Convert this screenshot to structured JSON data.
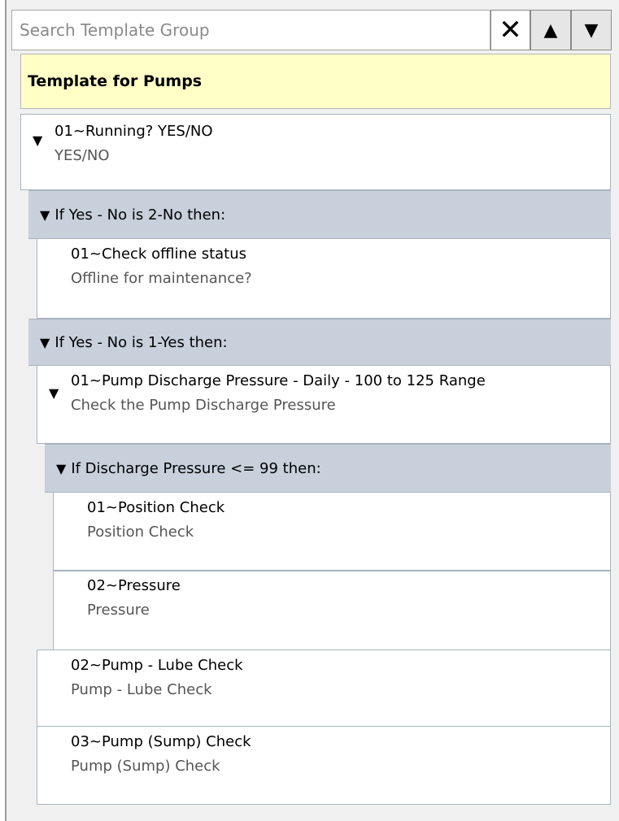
{
  "search": {
    "placeholder": "Search Template Group",
    "value": ""
  },
  "buttons": {
    "clear": "✕",
    "up": "▲",
    "down": "▼"
  },
  "header": {
    "title": "Template for Pumps"
  },
  "nodes": {
    "running": {
      "title": "01~Running? YES/NO",
      "subtitle": "YES/NO"
    },
    "check_offline": {
      "title": "01~Check offline status",
      "subtitle": "Offline for maintenance?"
    },
    "pump_discharge": {
      "title": "01~Pump Discharge Pressure - Daily - 100 to 125 Range",
      "subtitle": "Check the Pump Discharge Pressure"
    },
    "position_check": {
      "title": "01~Position Check",
      "subtitle": "Position Check"
    },
    "pressure": {
      "title": "02~Pressure",
      "subtitle": "Pressure"
    },
    "lube_check": {
      "title": "02~Pump - Lube Check",
      "subtitle": "Pump - Lube Check"
    },
    "sump_check": {
      "title": "03~Pump (Sump) Check",
      "subtitle": "Pump (Sump) Check"
    }
  },
  "conditions": {
    "if_no": "If Yes - No is 2-No then:",
    "if_yes": "If Yes - No is 1-Yes then:",
    "if_pressure": "If Discharge Pressure <= 99 then:"
  },
  "icons": {
    "expand": "▼"
  }
}
